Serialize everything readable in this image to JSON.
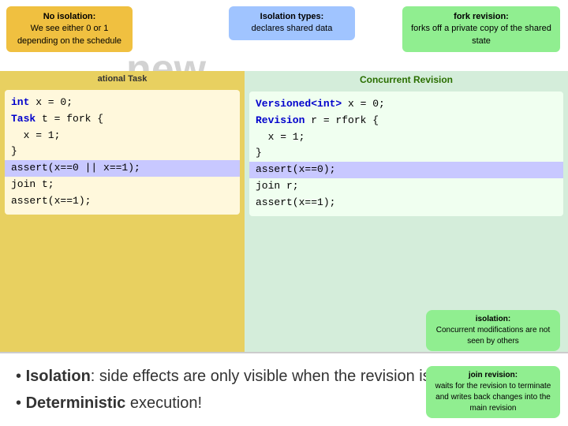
{
  "callouts": {
    "no_isolation": {
      "title": "No isolation:",
      "body": "We see either 0 or 1 depending on the schedule"
    },
    "isolation_types": {
      "title": "Isolation types:",
      "body": "declares shared data"
    },
    "fork_revision": {
      "title": "fork revision:",
      "body": "forks off a private copy of the shared state"
    },
    "isolation_def": {
      "title": "isolation:",
      "body": "Concurrent modifications are not seen by others"
    },
    "join_def": {
      "title": "join revision:",
      "body": "waits for the revision to terminate and writes back changes into the main revision"
    }
  },
  "new_label": "new",
  "left_panel": {
    "title": "ational Task",
    "code_lines": [
      "int x = 0;",
      "Task t = fork {",
      "  x = 1;",
      "}",
      "assert(x==0 || x==1);",
      "join t;",
      "assert(x==1);"
    ]
  },
  "right_panel": {
    "title": "Concurrent Revision",
    "code_lines": [
      "Versioned<int> x = 0;",
      "Revision r = rfork {",
      "  x = 1;",
      "}",
      "assert(x==0);",
      "join r;",
      "assert(x==1);"
    ]
  },
  "bullets": [
    {
      "term": "Isolation",
      "rest": ": side effects are only visible when the revision is joined."
    },
    {
      "term": "Deterministic",
      "rest": " execution!"
    }
  ]
}
